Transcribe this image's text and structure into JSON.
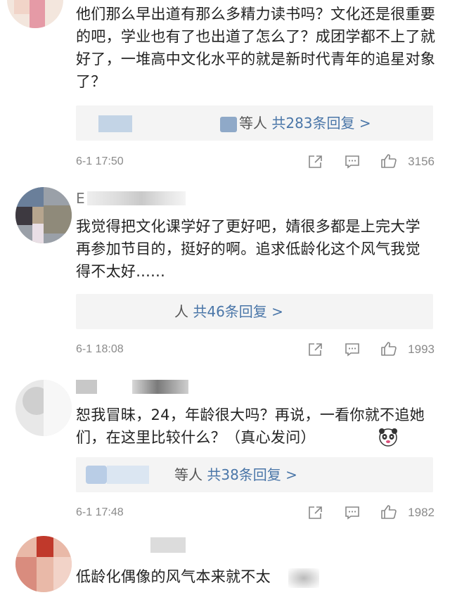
{
  "comments": [
    {
      "text": "他们那么早出道有那么多精力读书吗？文化还是很重要的吧，学业也有了也出道了怎么了？成团学都不上了就好了，一堆高中文化水平的就是新时代青年的追星对象了？",
      "reply_who": "等人",
      "reply_count": "共283条回复 >",
      "time": "6-1 17:50",
      "likes": "3156"
    },
    {
      "name_partial": "E",
      "text": "我觉得把文化课学好了更好吧，婧很多都是上完大学再参加节目的，挺好的啊。追求低龄化这个风气我觉得不太好......",
      "reply_who": "人",
      "reply_count": "共46条回复 >",
      "time": "6-1 18:08",
      "likes": "1993"
    },
    {
      "text": "恕我冒昧，24，年龄很大吗？再说，一看你就不追她们，在这里比较什么？（真心发问）",
      "reply_who": "等人",
      "reply_count": "共38条回复 >",
      "time": "6-1 17:48",
      "likes": "1982"
    },
    {
      "text": "低龄化偶像的风气本来就不太"
    }
  ],
  "icons": {
    "share": "share-icon",
    "comment": "comment-icon",
    "like": "thumbs-up-icon",
    "emoji": "panda-emoji-icon"
  },
  "colors": {
    "reply_count": "#4a76a8",
    "meta": "#8a8a8a",
    "reply_bg": "#f4f4f4"
  }
}
